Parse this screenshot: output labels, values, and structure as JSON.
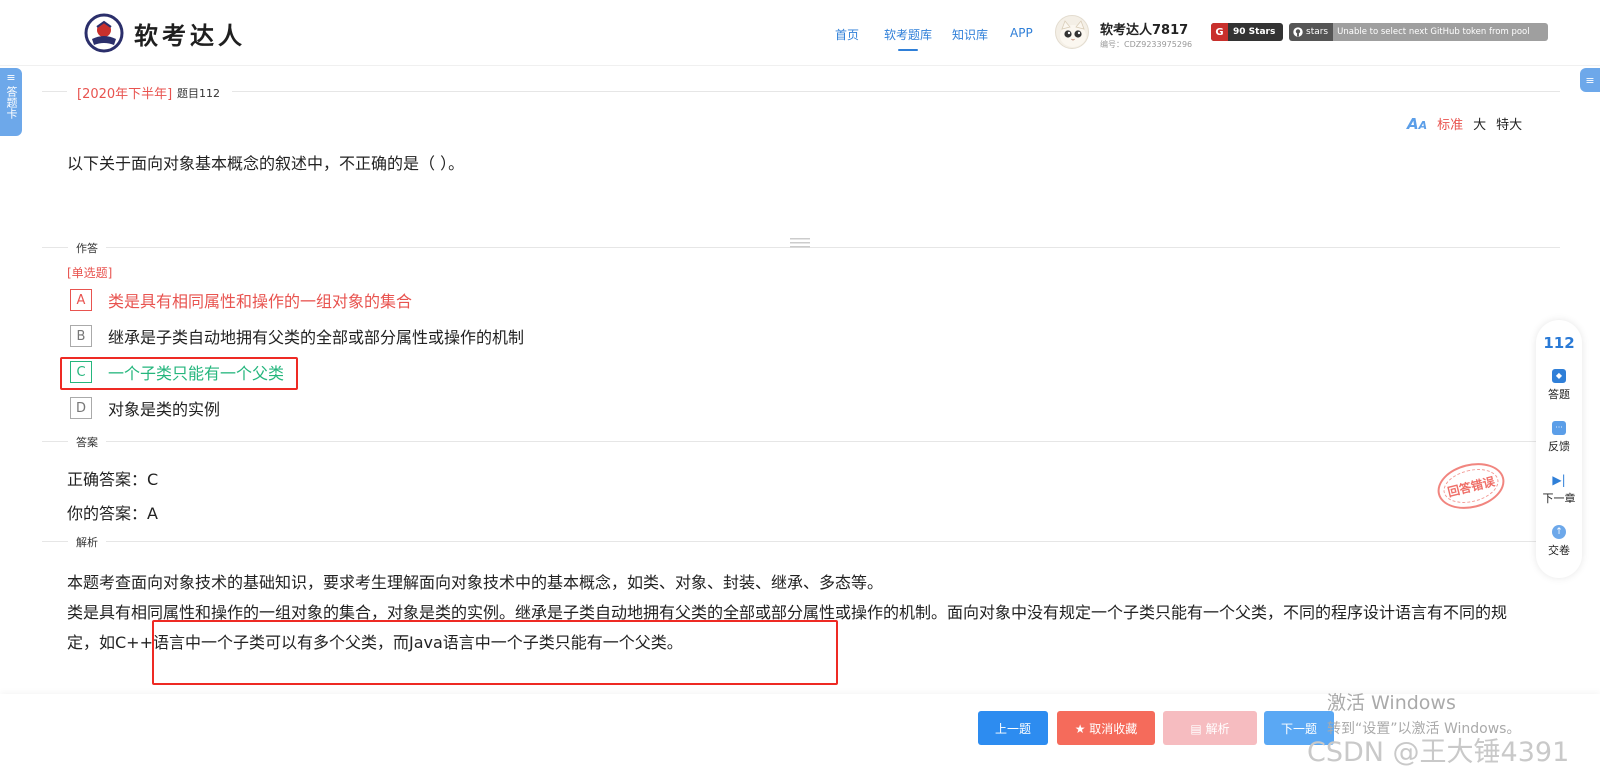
{
  "header": {
    "logo_text": "软考达人",
    "nav": [
      {
        "label": "首页"
      },
      {
        "label": "软考题库"
      },
      {
        "label": "知识库"
      },
      {
        "label": "APP"
      }
    ],
    "user": {
      "name": "软考达人7817",
      "id_text": "编号：CDZ9233975296"
    },
    "stars_badge": {
      "icon_text": "G",
      "label": "90 Stars"
    },
    "github_badge": {
      "left": "stars",
      "right": "Unable to select next GitHub token from pool"
    }
  },
  "side_tab": {
    "label": "答题卡"
  },
  "question": {
    "year_tag": "[2020年下半年]",
    "number_label": "题目112",
    "text": "以下关于面向对象基本概念的叙述中，不正确的是（ ）。",
    "type_label": "[单选题]",
    "options": [
      {
        "letter": "A",
        "text": "类是具有相同属性和操作的一组对象的集合",
        "state": "wrong"
      },
      {
        "letter": "B",
        "text": "继承是子类自动地拥有父类的全部或部分属性或操作的机制",
        "state": "normal"
      },
      {
        "letter": "C",
        "text": "一个子类只能有一个父类",
        "state": "correct"
      },
      {
        "letter": "D",
        "text": "对象是类的实例",
        "state": "normal"
      }
    ]
  },
  "font_size": {
    "options": [
      "标准",
      "大",
      "特大"
    ],
    "selected": "标准"
  },
  "sections": {
    "answer_area": "作答",
    "answer": "答案",
    "analysis": "解析"
  },
  "answer": {
    "correct": "正确答案：C",
    "yours": "你的答案：A"
  },
  "stamp_text": "回答错误",
  "analysis": {
    "line1": "本题考查面向对象技术的基础知识，要求考生理解面向对象技术中的基本概念，如类、对象、封装、继承、多态等。",
    "line2": "类是具有相同属性和操作的一组对象的集合，对象是类的实例。继承是子类自动地拥有父类的全部或部分属性或操作的机制。面向对象中没有规定一个子类只能有一个父类，不同的程序设计语言有不同的规定，如C++语言中一个子类可以有多个父类，而Java语言中一个子类只能有一个父类。"
  },
  "float_panel": {
    "number": "112",
    "items": [
      {
        "label": "答题"
      },
      {
        "label": "反馈"
      },
      {
        "label": "下一章"
      },
      {
        "label": "交卷"
      }
    ]
  },
  "buttons": {
    "prev": "上一题",
    "unfavorite": "★ 取消收藏",
    "analysis": "▤ 解析",
    "next": "下一题"
  },
  "watermarks": {
    "windows_line1": "激活 Windows",
    "windows_line2": "转到“设置”以激活 Windows。",
    "csdn": "CSDN @王大锤4391"
  },
  "colors": {
    "accent": "#2f7fd8",
    "wrong": "#e8534f",
    "correct": "#25b67d",
    "highlight_box": "#ee2a24"
  }
}
